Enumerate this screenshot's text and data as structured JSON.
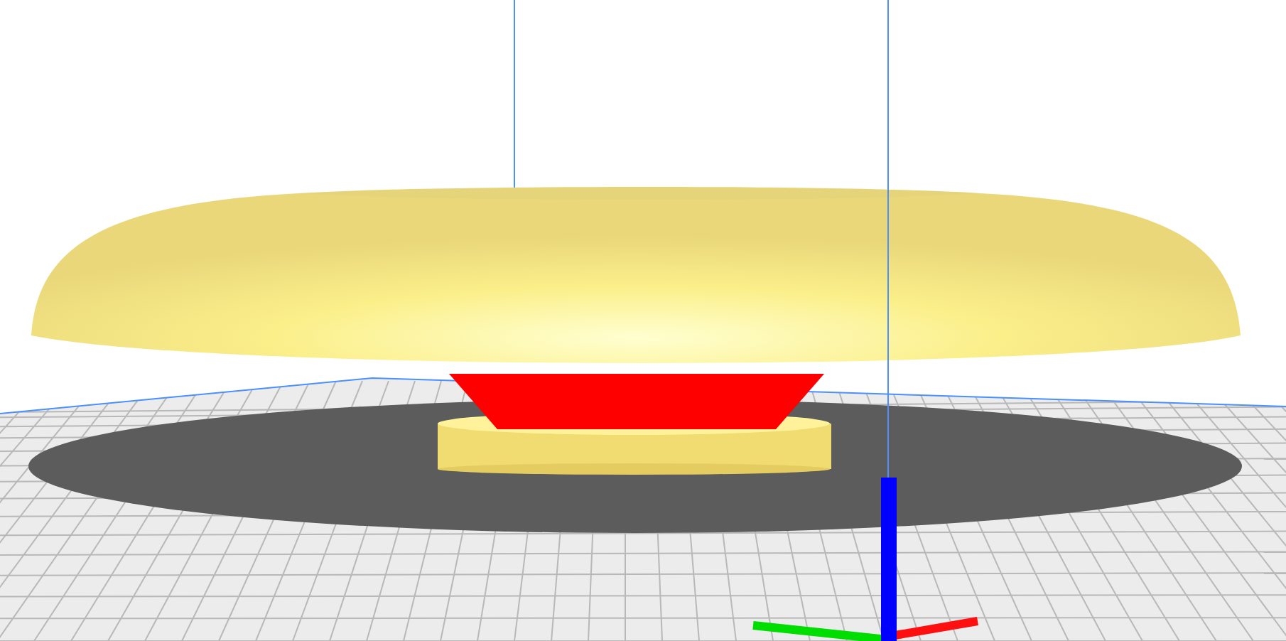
{
  "viewport": {
    "overhang_highlight": true,
    "axes_visible": true
  }
}
